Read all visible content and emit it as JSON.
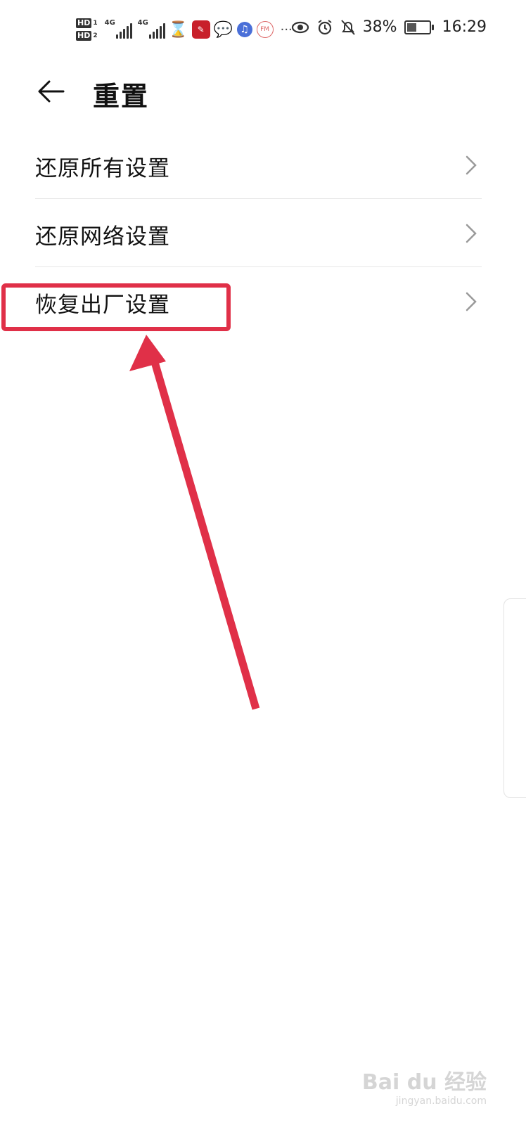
{
  "status_bar": {
    "hd1": "HD",
    "hd1_sub": "1",
    "hd2": "HD",
    "hd2_sub": "2",
    "net1": "4G",
    "net2": "4G",
    "more": "···",
    "battery": "38%",
    "time": "16:29",
    "icons": [
      "hourglass-icon",
      "app-red-icon",
      "chat-bubble-icon",
      "music-icon",
      "fm-radio-icon",
      "eye-icon",
      "alarm-icon",
      "bell-off-icon",
      "battery-charging-icon"
    ]
  },
  "header": {
    "title": "重置"
  },
  "menu": {
    "items": [
      {
        "label": "还原所有设置"
      },
      {
        "label": "还原网络设置"
      },
      {
        "label": "恢复出厂设置"
      }
    ]
  },
  "annotation": {
    "color": "#e03048"
  },
  "watermark": {
    "logo": "Bai du 经验",
    "sub": "jingyan.baidu.com"
  }
}
